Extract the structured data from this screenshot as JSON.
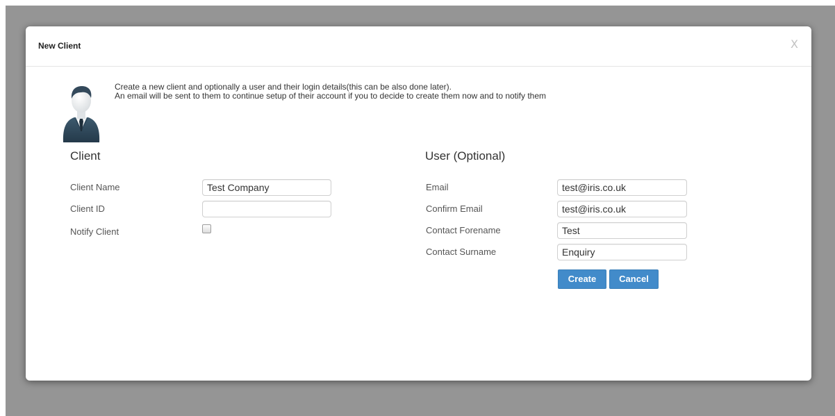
{
  "dialog": {
    "title": "New Client",
    "close_label": "X",
    "intro_line1": "Create a new client and optionally a user and their login details(this can be also done later).",
    "intro_line2": "An email will be sent to them to continue setup of their account if you to decide to create them now and to notify them"
  },
  "client": {
    "heading": "Client",
    "name_label": "Client Name",
    "name_value": "Test Company",
    "id_label": "Client ID",
    "id_value": "",
    "notify_label": "Notify Client",
    "notify_checked": false
  },
  "user": {
    "heading": "User (Optional)",
    "email_label": "Email",
    "email_value": "test@iris.co.uk",
    "confirm_label": "Confirm Email",
    "confirm_value": "test@iris.co.uk",
    "forename_label": "Contact Forename",
    "forename_value": "Test",
    "surname_label": "Contact Surname",
    "surname_value": "Enquiry"
  },
  "actions": {
    "create_label": "Create",
    "cancel_label": "Cancel"
  },
  "colors": {
    "overlay": "#959595",
    "button": "#428bca",
    "suit": "#2f4656"
  },
  "icons": {
    "avatar": "businessman-avatar-icon",
    "close": "close-icon"
  }
}
